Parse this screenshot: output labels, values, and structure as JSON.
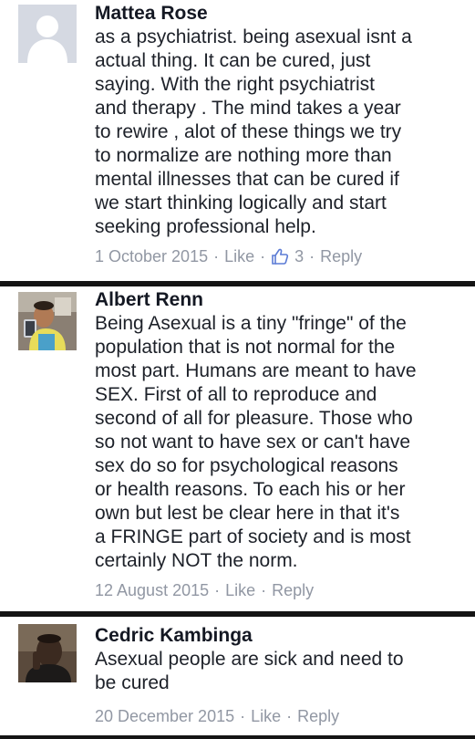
{
  "comments": [
    {
      "author": "Mattea Rose",
      "text": "as a psychiatrist. being asexual isnt a\nactual thing. It can be cured, just\nsaying. With the right psychiatrist\nand therapy . The mind takes a year\nto rewire , alot of these things we try\nto normalize are nothing more than\nmental illnesses that can be cured if\nwe start thinking logically and start\nseeking professional help.",
      "date": "1 October 2015",
      "like_label": "Like",
      "like_count": "3",
      "reply_label": "Reply",
      "avatar_icon": "default-profile-silhouette-icon"
    },
    {
      "author": "Albert Renn",
      "text": "Being Asexual is a tiny \"fringe\" of the\npopulation that is not normal for the\nmost part. Humans are meant to have\nSEX. First of all to reproduce and\nsecond of all for pleasure. Those who\nso not want to have sex or can't have\nsex do so for psychological reasons\nor health reasons. To each his or her\nown but lest be clear here in that it's\na FRINGE part of society and is most\ncertainly NOT the norm.",
      "date": "12 August 2015",
      "like_label": "Like",
      "reply_label": "Reply",
      "avatar_icon": "profile-photo-selfie"
    },
    {
      "author": "Cedric Kambinga",
      "text": "Asexual people are sick and need to\nbe cured",
      "date": "20 December 2015",
      "like_label": "Like",
      "reply_label": "Reply",
      "avatar_icon": "profile-photo-portrait"
    }
  ],
  "separator": "·",
  "colors": {
    "author": "#141823",
    "text": "#1d2129",
    "meta": "#9197a3",
    "divider": "#141414",
    "like_icon": "#5b7bd5"
  }
}
